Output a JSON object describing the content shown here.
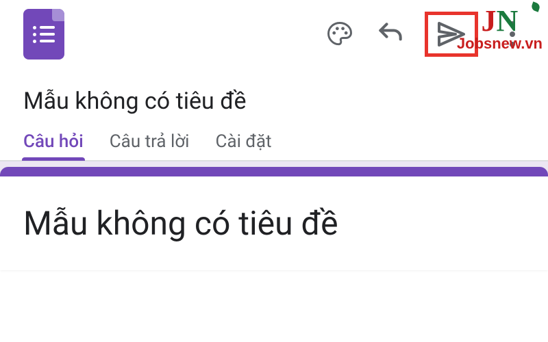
{
  "header": {
    "form_title": "Mẫu không có tiêu đề"
  },
  "tabs": {
    "questions": "Câu hỏi",
    "responses": "Câu trả lời",
    "settings": "Cài đặt"
  },
  "card": {
    "title": "Mẫu không có tiêu đề"
  },
  "watermark": {
    "brand_j": "J",
    "brand_n": "N",
    "site": "Jobsnew.vn"
  },
  "colors": {
    "primary": "#7248B9",
    "highlight": "#E8342C"
  }
}
